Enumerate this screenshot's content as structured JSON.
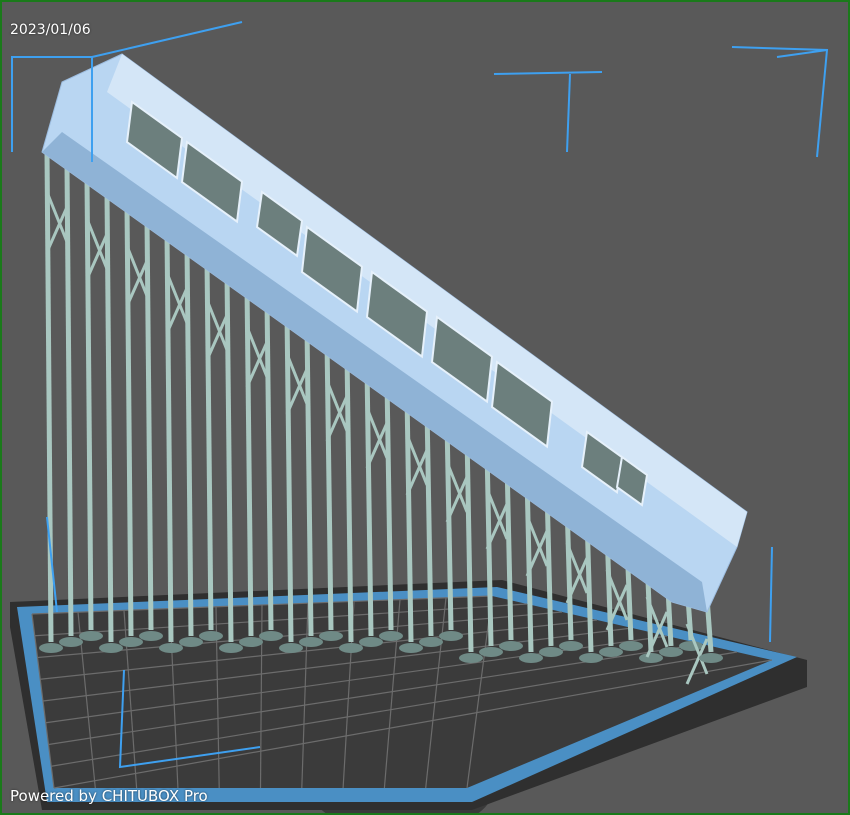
{
  "viewer": {
    "date": "2023/01/06",
    "watermark": "Powered by CHITUBOX Pro"
  },
  "colors": {
    "frame": "#1a7a1a",
    "background": "#595959",
    "model": "#b9d6f2",
    "model_shadow": "#8fb3d6",
    "supports": "#a9c7c0",
    "plate_border": "#4a8fc4",
    "plate": "#3d3d3d",
    "grid": "#6a6a6a",
    "bbox": "#3ea0f0"
  }
}
